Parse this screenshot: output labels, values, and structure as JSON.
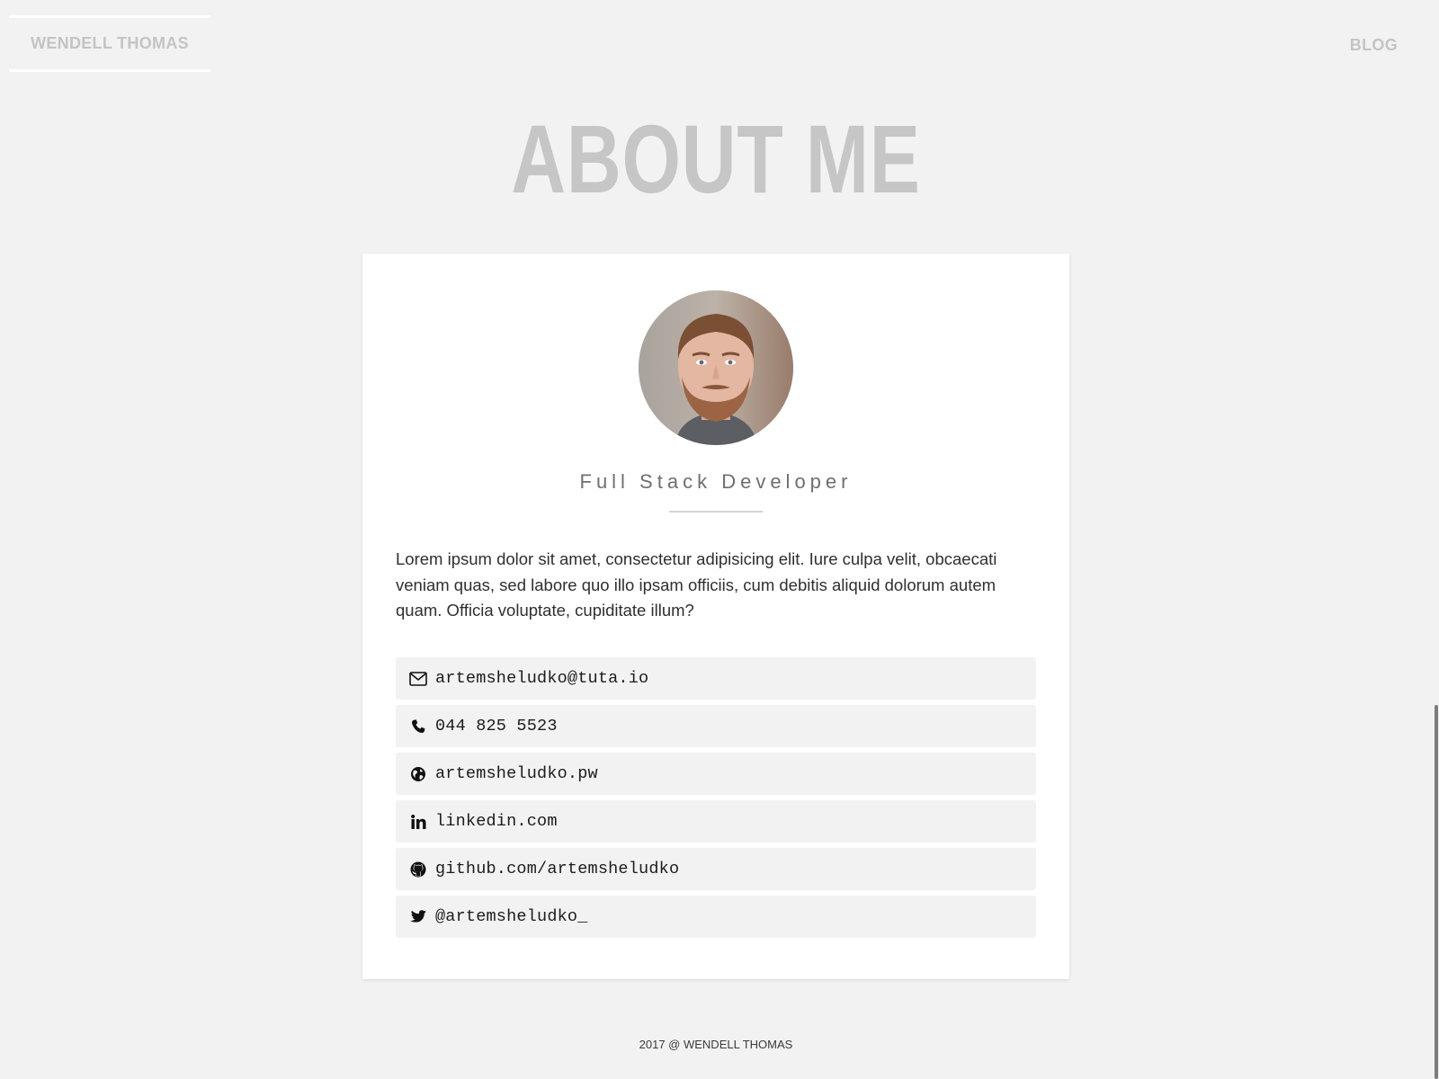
{
  "header": {
    "brand": "WENDELL THOMAS",
    "nav_blog": "BLOG"
  },
  "page": {
    "title": "ABOUT ME"
  },
  "profile": {
    "role": "Full Stack Developer",
    "bio": "Lorem ipsum dolor sit amet, consectetur adipisicing elit. Iure culpa velit, obcaecati veniam quas, sed labore quo illo ipsam officiis, cum debitis aliquid dolorum autem quam. Officia voluptate, cupiditate illum?"
  },
  "contacts": [
    {
      "icon": "envelope-icon",
      "text": "artemsheludko@tuta.io"
    },
    {
      "icon": "phone-icon",
      "text": "044 825 5523"
    },
    {
      "icon": "globe-icon",
      "text": "artemsheludko.pw"
    },
    {
      "icon": "linkedin-icon",
      "text": "linkedin.com"
    },
    {
      "icon": "github-icon",
      "text": "github.com/artemsheludko"
    },
    {
      "icon": "twitter-icon",
      "text": "@artemsheludko_"
    }
  ],
  "footer": {
    "text": "2017 @ WENDELL THOMAS"
  },
  "colors": {
    "background": "#f2f2f2",
    "card": "#ffffff",
    "muted_text": "#c4c4c4",
    "title": "#c6c6c6",
    "contact_bg": "#f2f2f2"
  }
}
